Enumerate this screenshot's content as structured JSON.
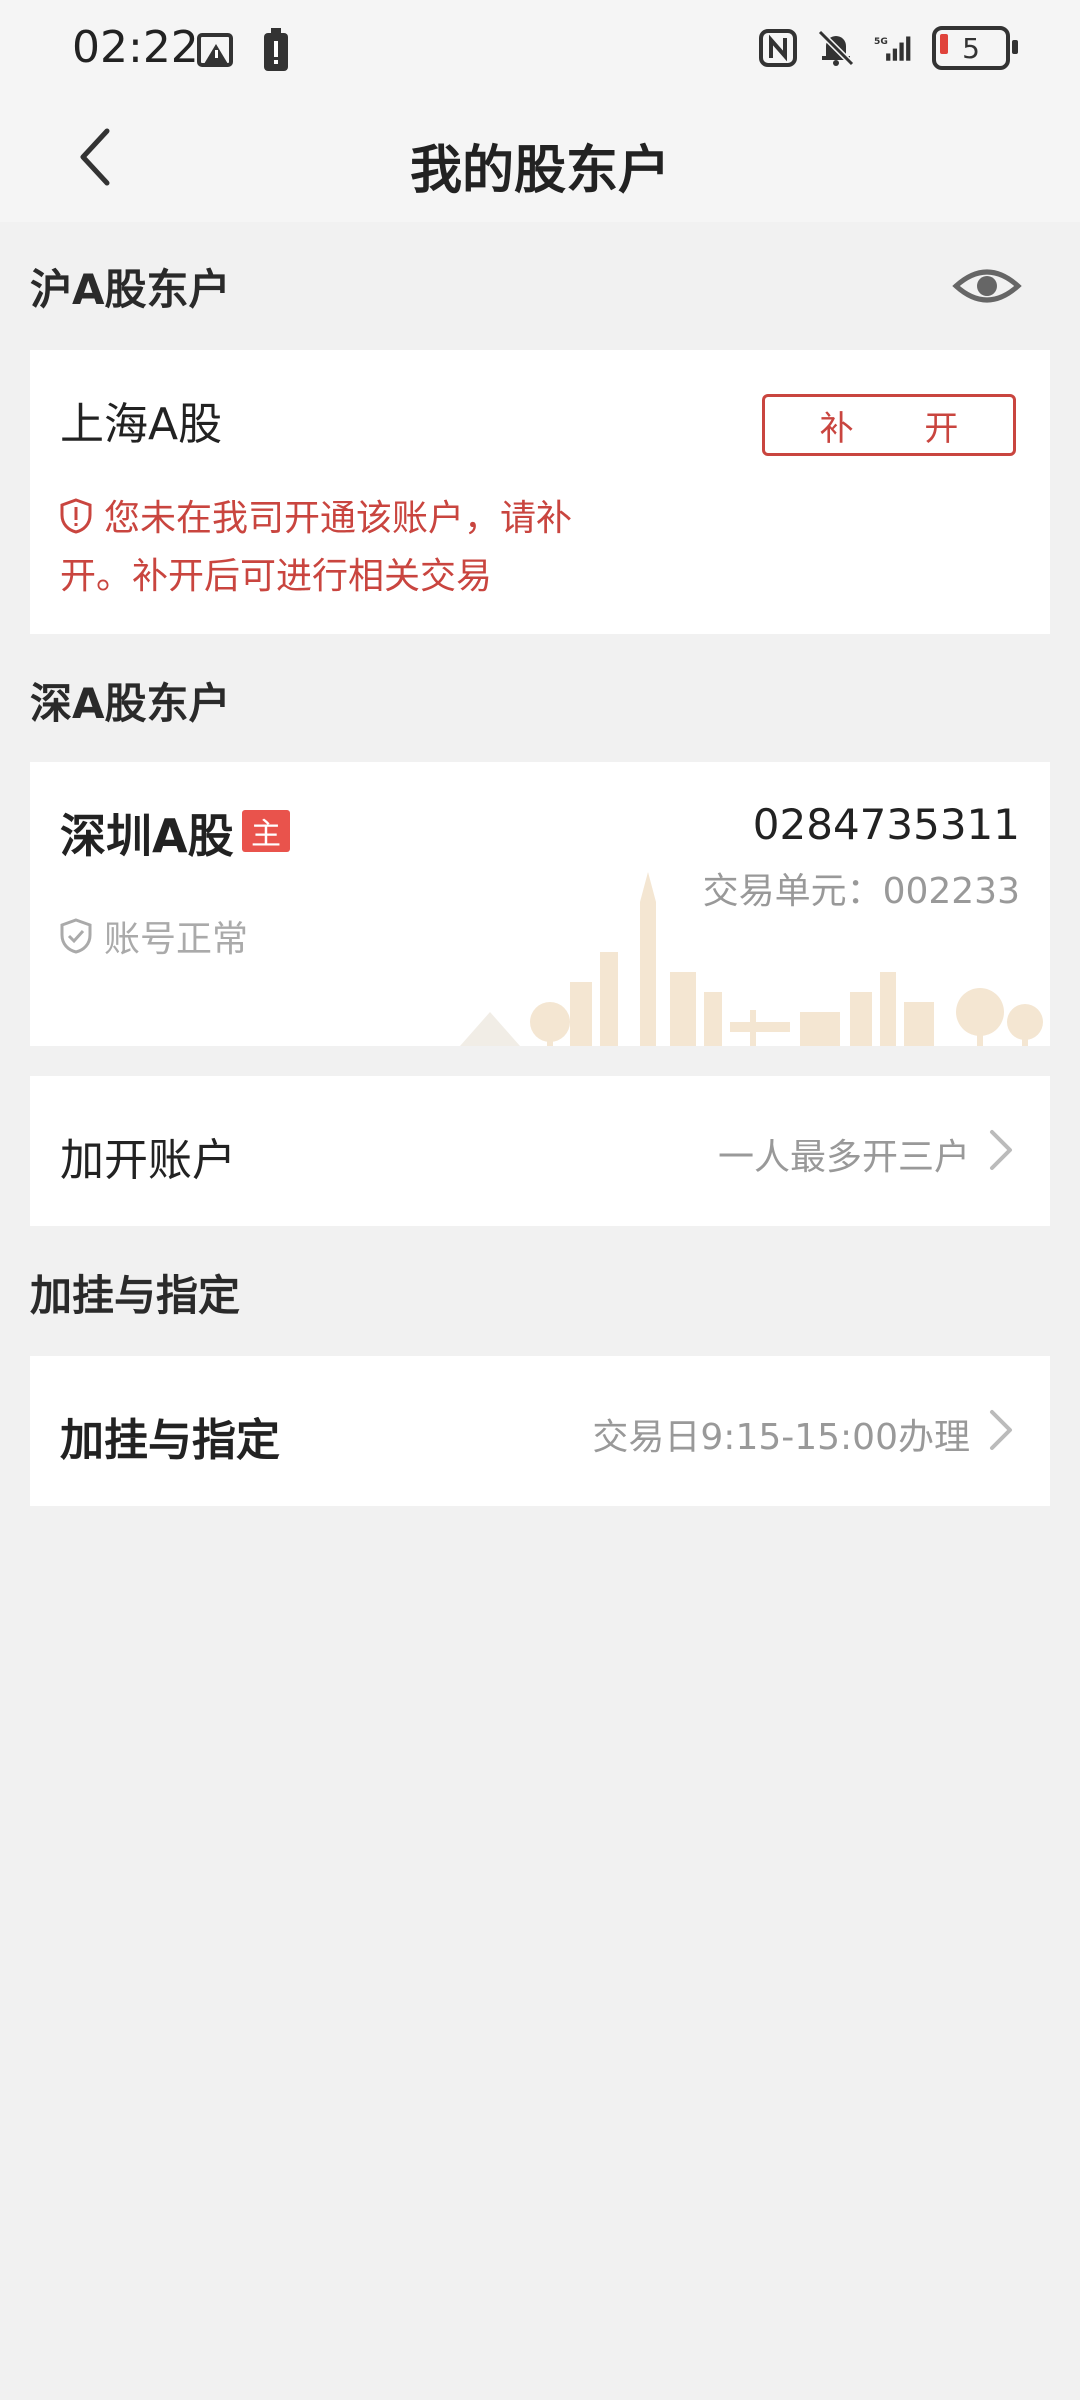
{
  "status": {
    "time": "02:22",
    "battery": "5"
  },
  "nav": {
    "title": "我的股东户"
  },
  "sh_section": {
    "title": "沪A股东户",
    "card": {
      "title": "上海A股",
      "button": "补 开",
      "warning": "您未在我司开通该账户，请补开。补开后可进行相关交易"
    }
  },
  "sz_section": {
    "title": "深A股东户",
    "card": {
      "title": "深圳A股",
      "badge": "主",
      "account_no": "0284735311",
      "trade_unit": "交易单元：002233",
      "status": "账号正常"
    }
  },
  "add_account": {
    "label": "加开账户",
    "hint": "一人最多开三户"
  },
  "designate_section": {
    "title": "加挂与指定",
    "row": {
      "label": "加挂与指定",
      "hint": "交易日9:15-15:00办理"
    }
  },
  "colors": {
    "accent": "#c9453f",
    "badge": "#e9534c",
    "background": "#f1f1f1"
  }
}
